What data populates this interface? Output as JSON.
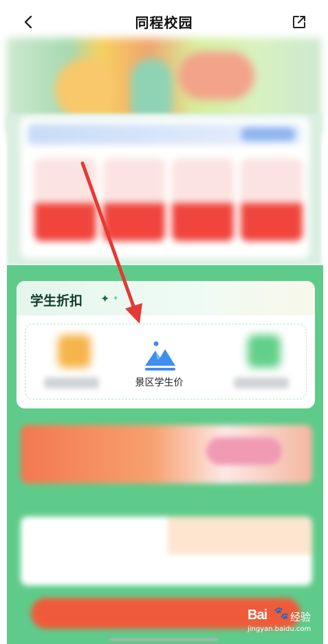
{
  "header": {
    "title": "同程校园",
    "back_icon": "chevron-left-icon",
    "share_icon": "external-link-icon"
  },
  "discount_section": {
    "title": "学生折扣",
    "sparkle_icon": "sparkle-icon",
    "items": [
      {
        "label": "",
        "icon": "blurred-orange-icon"
      },
      {
        "label": "景区学生价",
        "icon": "mountain-icon"
      },
      {
        "label": "",
        "icon": "blurred-green-icon"
      }
    ]
  },
  "watermark": {
    "brand": "Bai",
    "paw": "🐾",
    "suffix": "经验",
    "url": "jingyan.baidu.com"
  },
  "colors": {
    "accent_green": "#5fcb8b",
    "arrow_red": "#e53935",
    "mountain_blue": "#3f8ef0"
  }
}
